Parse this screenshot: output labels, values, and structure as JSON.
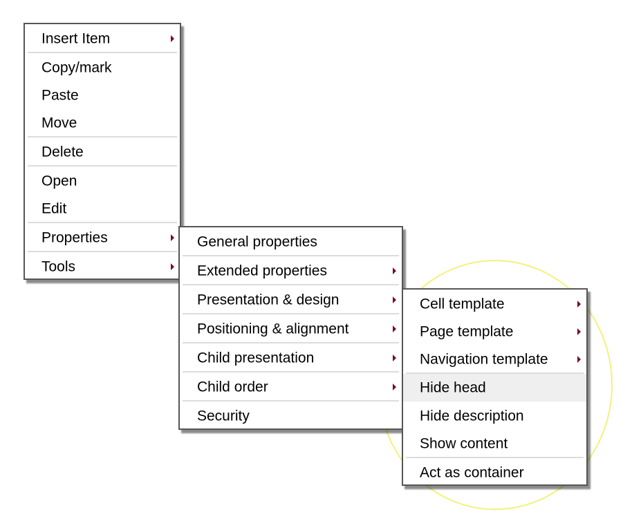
{
  "menus": {
    "main": {
      "items": [
        {
          "label": "Insert Item",
          "submenu": true
        },
        {
          "label": "Copy/mark",
          "submenu": false
        },
        {
          "label": "Paste",
          "submenu": false
        },
        {
          "label": "Move",
          "submenu": false
        },
        {
          "label": "Delete",
          "submenu": false
        },
        {
          "label": "Open",
          "submenu": false
        },
        {
          "label": "Edit",
          "submenu": false
        },
        {
          "label": "Properties",
          "submenu": true
        },
        {
          "label": "Tools",
          "submenu": true
        }
      ]
    },
    "properties": {
      "items": [
        {
          "label": "General properties",
          "submenu": false
        },
        {
          "label": "Extended properties",
          "submenu": true
        },
        {
          "label": "Presentation & design",
          "submenu": true
        },
        {
          "label": "Positioning & alignment",
          "submenu": true
        },
        {
          "label": "Child presentation",
          "submenu": true
        },
        {
          "label": "Child order",
          "submenu": true
        },
        {
          "label": "Security",
          "submenu": false
        }
      ]
    },
    "presentation": {
      "items": [
        {
          "label": "Cell template",
          "submenu": true
        },
        {
          "label": "Page template",
          "submenu": true
        },
        {
          "label": "Navigation template",
          "submenu": true
        },
        {
          "label": "Hide head",
          "submenu": false,
          "highlighted": true
        },
        {
          "label": "Hide description",
          "submenu": false
        },
        {
          "label": "Show content",
          "submenu": false
        },
        {
          "label": "Act as container",
          "submenu": false
        }
      ]
    }
  },
  "colors": {
    "arrow": "#7a0a28",
    "highlight": "#efefef",
    "annotation_ring": "#f2f27a"
  },
  "annotation": {
    "type": "highlight-circle",
    "target": "presentation-submenu"
  }
}
